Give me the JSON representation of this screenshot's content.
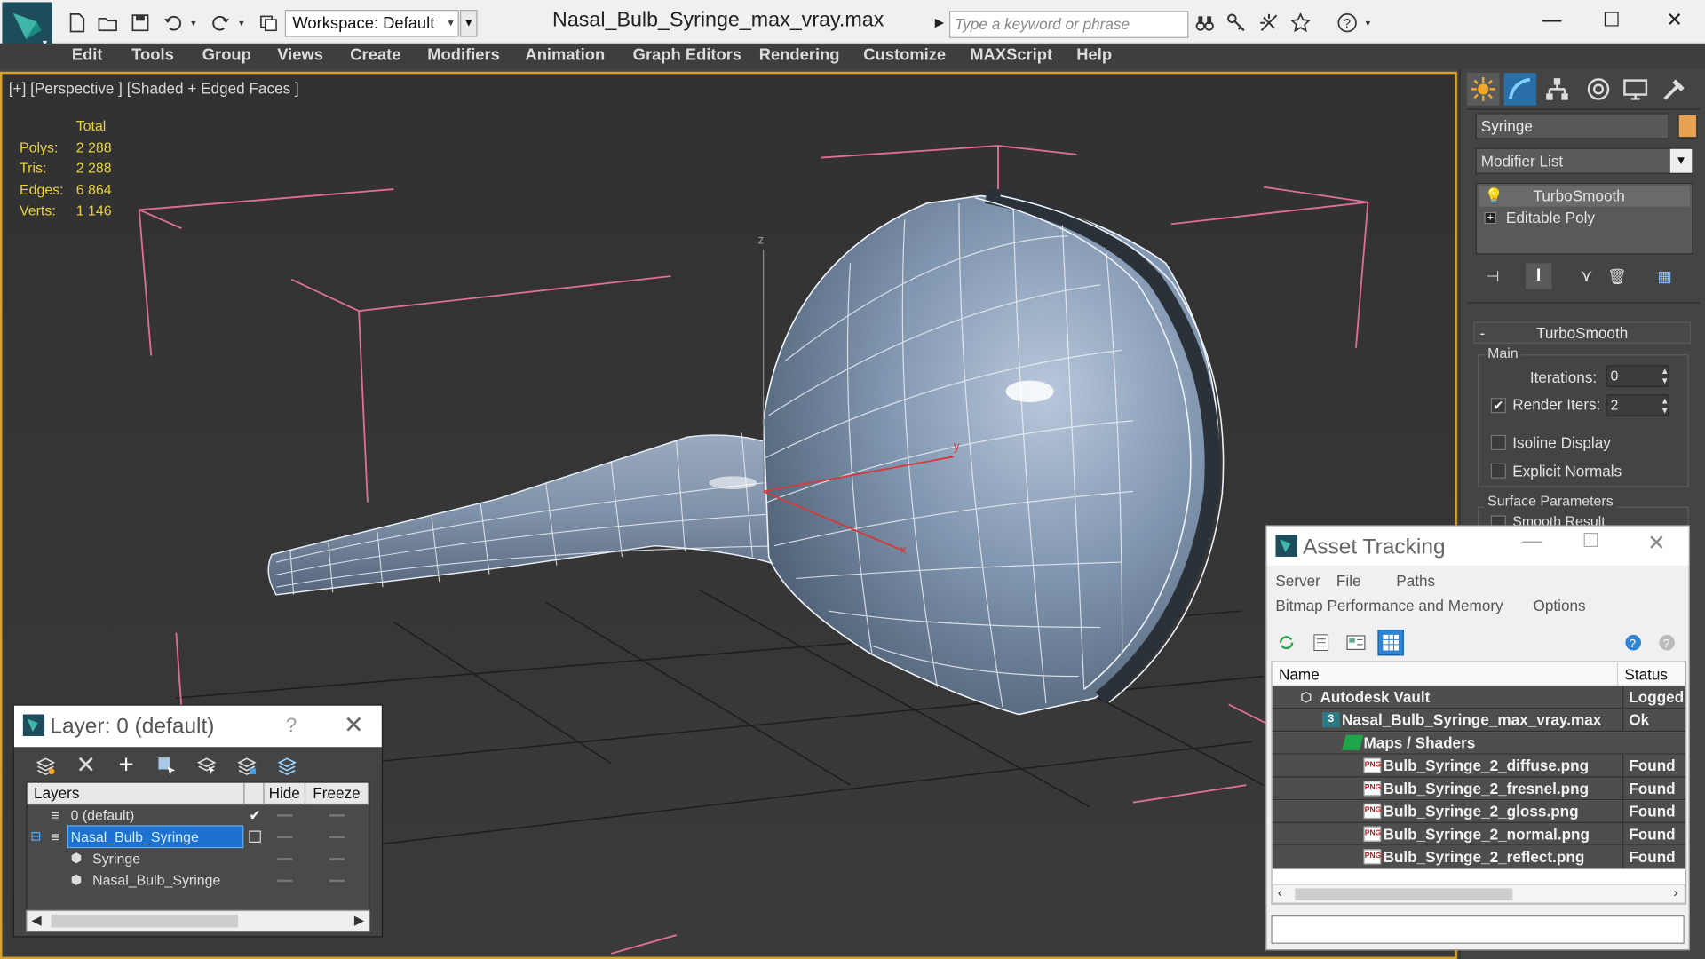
{
  "titlebar": {
    "workspace": "Workspace: Default",
    "file_title": "Nasal_Bulb_Syringe_max_vray.max",
    "search_placeholder": "Type a keyword or phrase"
  },
  "menu": [
    "Edit",
    "Tools",
    "Group",
    "Views",
    "Create",
    "Modifiers",
    "Animation",
    "Graph Editors",
    "Rendering",
    "Customize",
    "MAXScript",
    "Help"
  ],
  "viewport": {
    "label": "[+] [Perspective ] [Shaded + Edged Faces ]",
    "stats_header": "Total",
    "stats": [
      {
        "key": "Polys:",
        "value": "2 288"
      },
      {
        "key": "Tris:",
        "value": "2 288"
      },
      {
        "key": "Edges:",
        "value": "6 864"
      },
      {
        "key": "Verts:",
        "value": "1 146"
      }
    ],
    "gizmo_x": "x",
    "gizmo_y": "y",
    "gizmo_z": "z"
  },
  "command_panel": {
    "object_name": "Syringe",
    "object_color": "#e8a050",
    "modifier_list": "Modifier List",
    "stack": [
      "TurboSmooth",
      "Editable Poly"
    ],
    "rollout_title": "TurboSmooth",
    "main_group": "Main",
    "iterations_label": "Iterations:",
    "iterations_value": "0",
    "render_iters_label": "Render Iters:",
    "render_iters_value": "2",
    "render_iters_checked": "✔",
    "isoline_label": "Isoline Display",
    "explicit_normals_label": "Explicit Normals",
    "surface_group": "Surface Parameters",
    "smooth_result_label": "Smooth Result"
  },
  "layer_dialog": {
    "title": "Layer: 0 (default)",
    "help": "?",
    "close": "✕",
    "col_layers": "Layers",
    "col_hide": "Hide",
    "col_freeze": "Freeze",
    "rows": [
      {
        "name": "0 (default)",
        "check": "✔"
      },
      {
        "name": "Nasal_Bulb_Syringe"
      },
      {
        "name": "Syringe"
      },
      {
        "name": "Nasal_Bulb_Syringe"
      }
    ],
    "expander": "⊟"
  },
  "asset_tracking": {
    "title": "Asset Tracking",
    "menu1": [
      "Server",
      "File",
      "Paths"
    ],
    "menu2": [
      "Bitmap Performance and Memory",
      "Options"
    ],
    "col_name": "Name",
    "col_status": "Status",
    "rows": [
      {
        "name": "Autodesk Vault",
        "status": "Logged"
      },
      {
        "name": "Nasal_Bulb_Syringe_max_vray.max",
        "status": "Ok"
      },
      {
        "name": "Maps / Shaders",
        "status": ""
      },
      {
        "name": "Bulb_Syringe_2_diffuse.png",
        "status": "Found"
      },
      {
        "name": "Bulb_Syringe_2_fresnel.png",
        "status": "Found"
      },
      {
        "name": "Bulb_Syringe_2_gloss.png",
        "status": "Found"
      },
      {
        "name": "Bulb_Syringe_2_normal.png",
        "status": "Found"
      },
      {
        "name": "Bulb_Syringe_2_reflect.png",
        "status": "Found"
      }
    ],
    "max_badge": "3",
    "png_badge": "PNG"
  },
  "window_controls": {
    "minimize": "—",
    "maximize": "☐",
    "close": "✕"
  }
}
